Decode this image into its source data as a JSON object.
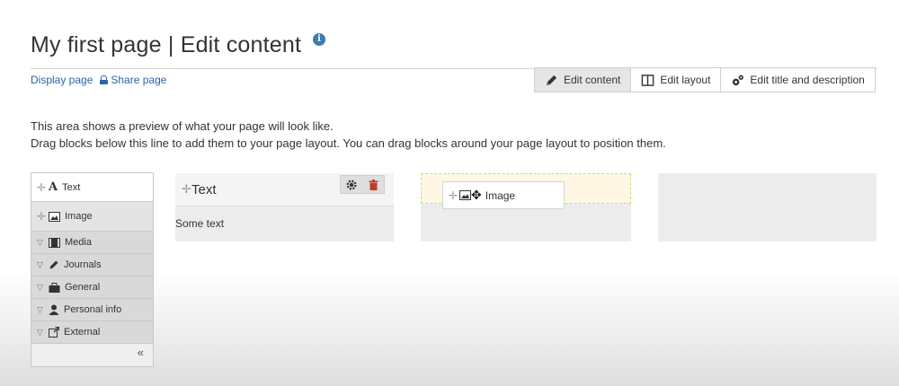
{
  "header": {
    "title": "My first page | Edit content",
    "info_icon": "info-icon",
    "links": [
      {
        "label": "Display page"
      },
      {
        "label": "Share page",
        "icon": "lock-icon"
      }
    ]
  },
  "tabs": [
    {
      "label": "Edit content",
      "icon": "pencil-icon",
      "active": true
    },
    {
      "label": "Edit layout",
      "icon": "columns-icon",
      "active": false
    },
    {
      "label": "Edit title and description",
      "icon": "gears-icon",
      "active": false
    }
  ],
  "intro": {
    "line1": "This area shows a preview of what your page will look like.",
    "line2": "Drag blocks below this line to add them to your page layout. You can drag blocks around your page layout to position them."
  },
  "palette": {
    "items": [
      {
        "label": "Text",
        "icon": "text-icon"
      },
      {
        "label": "Image",
        "icon": "image-icon"
      },
      {
        "label": "Media",
        "icon": "film-icon"
      },
      {
        "label": "Journals",
        "icon": "pencil-icon"
      },
      {
        "label": "General",
        "icon": "briefcase-icon"
      },
      {
        "label": "Personal info",
        "icon": "user-icon"
      },
      {
        "label": "External",
        "icon": "external-link-icon"
      }
    ],
    "collapse_label": "«"
  },
  "layout": {
    "text_block": {
      "title": "Text",
      "body": "Some text"
    },
    "dragging_block": {
      "title": "Image"
    }
  },
  "colors": {
    "link": "#2a64a4",
    "active_tab": "#e6e6e6",
    "drop_zone": "#fdf7e3",
    "delete_icon": "#c0392b"
  }
}
